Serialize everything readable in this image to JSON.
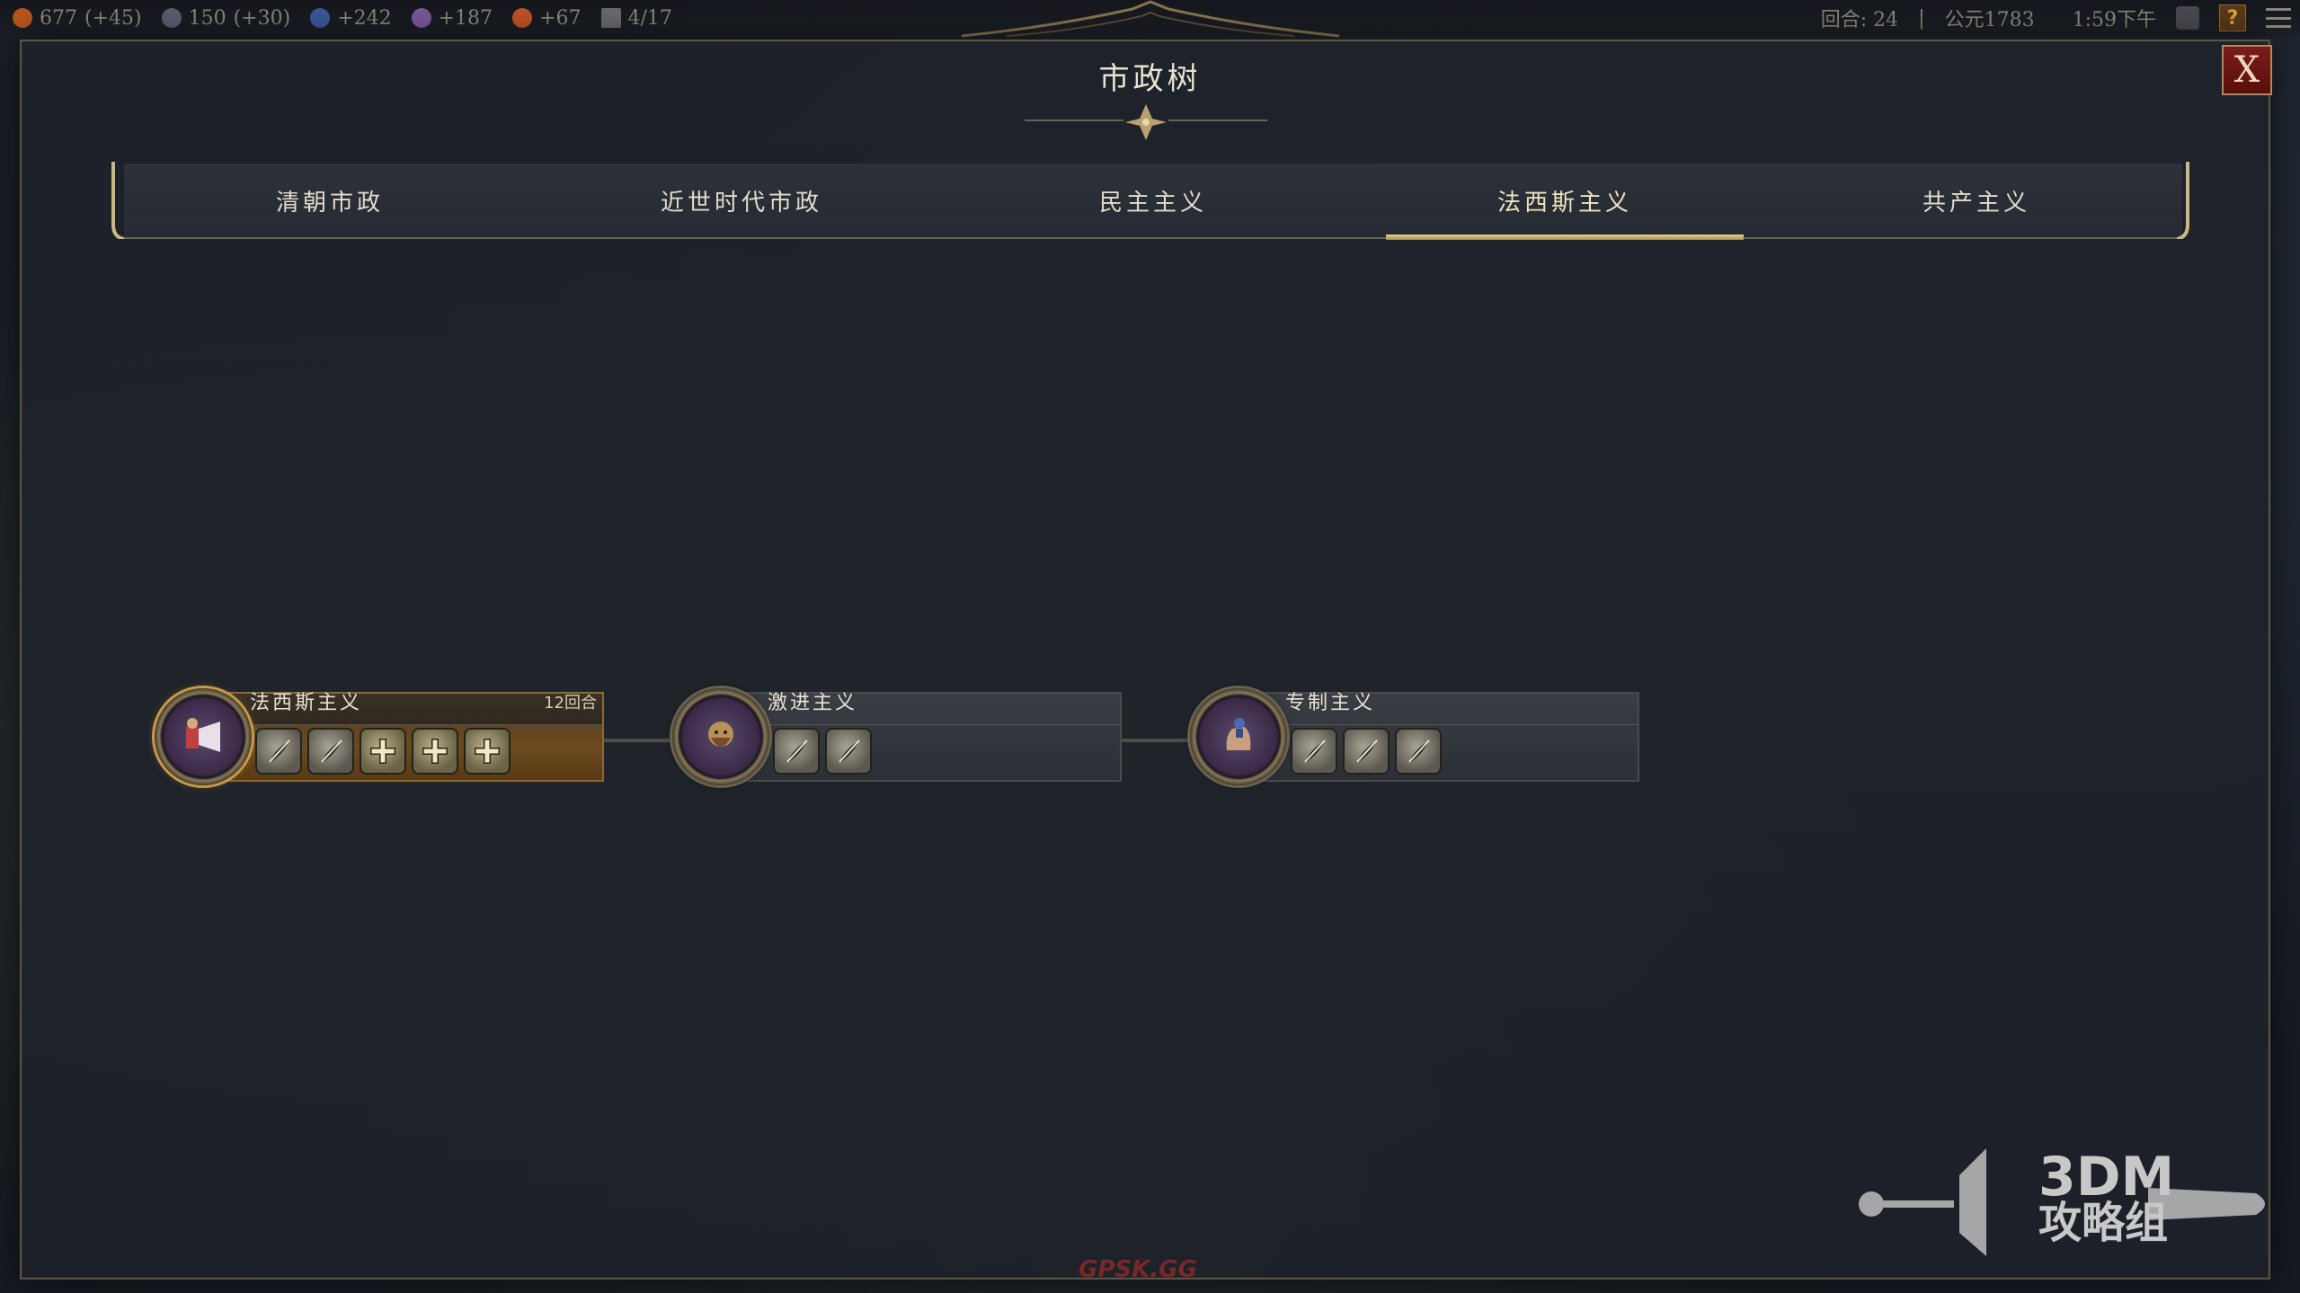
{
  "topbar": {
    "resources": [
      {
        "icon": "gold-icon",
        "value": "677",
        "delta": "(+45)",
        "color": "#b8581e"
      },
      {
        "icon": "globe-icon",
        "value": "150",
        "delta": "(+30)",
        "color": "#5a6070"
      },
      {
        "icon": "science-flask-icon",
        "value": "+242",
        "delta": "",
        "color": "#3a5a9a"
      },
      {
        "icon": "music-note-icon",
        "value": "+187",
        "delta": "",
        "color": "#7a5a9a"
      },
      {
        "icon": "faith-icon",
        "value": "+67",
        "delta": "",
        "color": "#c0542a"
      },
      {
        "icon": "city-icon",
        "value": "4/17",
        "delta": "",
        "color": "#6a6a70"
      }
    ],
    "turn_label": "回合: 24",
    "year_label": "公元1783",
    "time": "1:59下午"
  },
  "panel": {
    "title": "市政树",
    "close_label": "X"
  },
  "tabs": [
    {
      "label": "清朝市政",
      "active": false
    },
    {
      "label": "近世时代市政",
      "active": false
    },
    {
      "label": "民主主义",
      "active": false
    },
    {
      "label": "法西斯主义",
      "active": true
    },
    {
      "label": "共产主义",
      "active": false
    }
  ],
  "civics": [
    {
      "name": "法西斯主义",
      "turns": "12回合",
      "status": "researching",
      "icon": "fascism-civic-icon",
      "unlocks": [
        "quill-icon",
        "quill-icon",
        "plus-icon",
        "plus-icon",
        "plus-icon"
      ]
    },
    {
      "name": "激进主义",
      "turns": "",
      "status": "locked",
      "icon": "radicalism-civic-icon",
      "unlocks": [
        "quill-icon",
        "quill-icon"
      ]
    },
    {
      "name": "专制主义",
      "turns": "",
      "status": "locked",
      "icon": "autocracy-civic-icon",
      "unlocks": [
        "quill-icon",
        "quill-icon",
        "quill-icon"
      ]
    }
  ],
  "watermark": {
    "line1": "3DM",
    "line2": "攻略组",
    "bottom": "GPSK.GG"
  },
  "colors": {
    "accent_gold": "#d4b878",
    "close_red": "#7a1c1c"
  }
}
